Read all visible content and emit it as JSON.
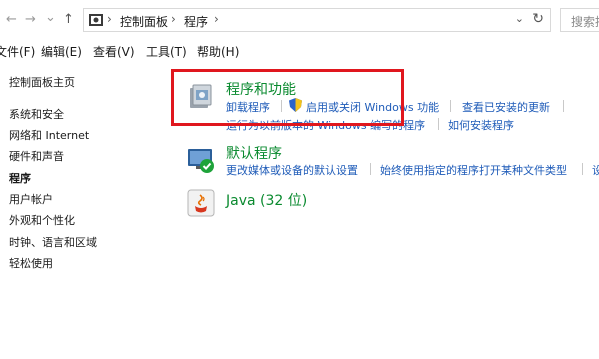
{
  "address_bar": {
    "back_glyph": "←",
    "forward_glyph": "→",
    "recent_glyph": "⌄",
    "up_glyph": "↑",
    "crumbs": [
      "控制面板",
      "程序"
    ],
    "separator": "›",
    "dropdown_glyph": "⌄",
    "refresh_glyph": "↻",
    "search_placeholder": "搜索控制面板"
  },
  "menubar": [
    "文件(F)",
    "编辑(E)",
    "查看(V)",
    "工具(T)",
    "帮助(H)"
  ],
  "sidebar": {
    "home": "控制面板主页",
    "items": [
      "系统和安全",
      "网络和 Internet",
      "硬件和声音",
      "程序",
      "用户帐户",
      "外观和个性化",
      "时钟、语言和区域",
      "轻松使用"
    ],
    "selected_index": 3
  },
  "categories": [
    {
      "title": "程序和功能",
      "icon": "programs-features-icon",
      "links": [
        "卸载程序",
        "启用或关闭 Windows 功能",
        "查看已安装的更新",
        "运行为以前版本的 Windows 编写的程序",
        "如何安装程序"
      ]
    },
    {
      "title": "默认程序",
      "icon": "default-programs-icon",
      "links": [
        "更改媒体或设备的默认设置",
        "始终使用指定的程序打开某种文件类型",
        "设"
      ]
    },
    {
      "title": "Java (32 位)",
      "icon": "java-icon",
      "links": []
    }
  ],
  "colors": {
    "title_green": "#0a8a2f",
    "link_blue": "#1e5bb8",
    "highlight_red": "#e0171e"
  }
}
